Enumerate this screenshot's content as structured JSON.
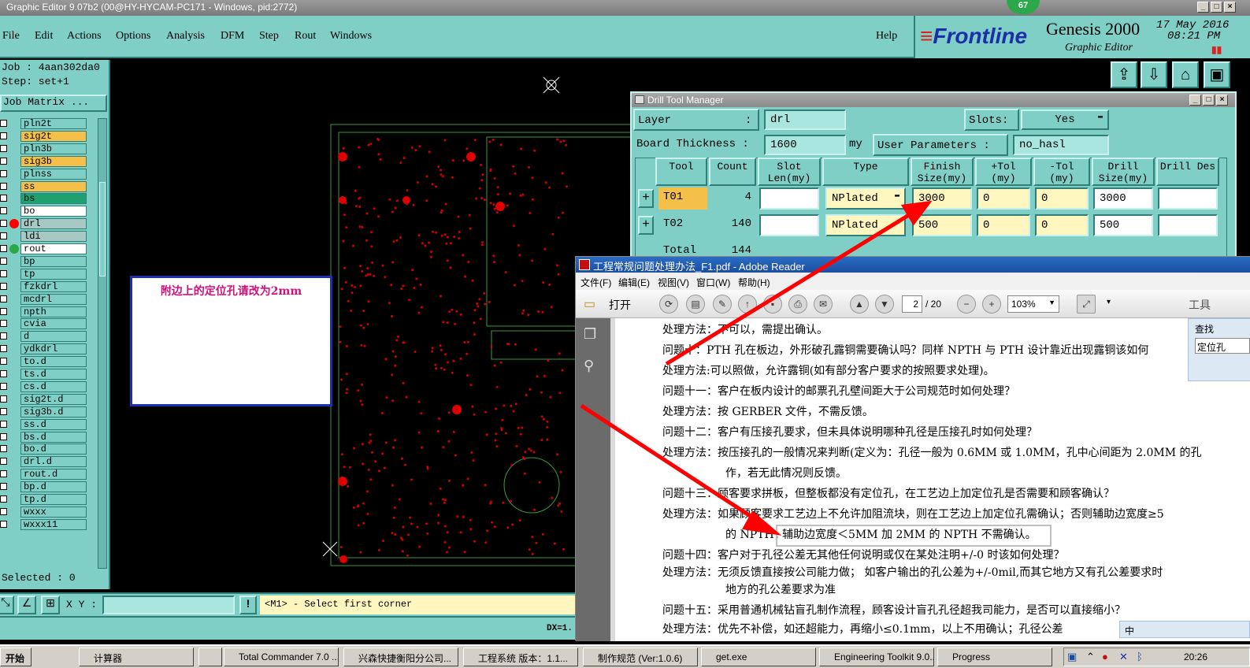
{
  "window": {
    "title": "Graphic Editor 9.07b2 (00@HY-HYCAM-PC171 - Windows, pid:2772)",
    "badge": "67"
  },
  "menu": {
    "items": [
      "File",
      "Edit",
      "Actions",
      "Options",
      "Analysis",
      "DFM",
      "Step",
      "Rout",
      "Windows"
    ],
    "help": "Help"
  },
  "brand": {
    "logo": "Frontline",
    "product": "Genesis 2000",
    "subtitle": "Graphic Editor",
    "date": "17 May 2016",
    "time": "08:21 PM"
  },
  "left_panel": {
    "job": "Job : 4aan302da0",
    "step": "Step: set+1",
    "job_matrix": "Job Matrix ...",
    "selected": "Selected : 0",
    "layers": [
      {
        "name": "pln2t",
        "color": "#7fcfc7"
      },
      {
        "name": "sig2t",
        "color": "#f5c04a"
      },
      {
        "name": "pln3b",
        "color": "#7fcfc7"
      },
      {
        "name": "sig3b",
        "color": "#f5c04a"
      },
      {
        "name": "plnss",
        "color": "#7fcfc7"
      },
      {
        "name": "ss",
        "color": "#f5c04a"
      },
      {
        "name": "bs",
        "color": "#20a070"
      },
      {
        "name": "bo",
        "color": "#ffffff"
      },
      {
        "name": "drl",
        "color": "#a8c8c4"
      },
      {
        "name": "ldi",
        "color": "#a8c8c4"
      },
      {
        "name": "rout",
        "color": "#ffffff"
      },
      {
        "name": "bp",
        "color": "#7fcfc7"
      },
      {
        "name": "tp",
        "color": "#7fcfc7"
      },
      {
        "name": "fzkdrl",
        "color": "#7fcfc7"
      },
      {
        "name": "mcdrl",
        "color": "#7fcfc7"
      },
      {
        "name": "npth",
        "color": "#7fcfc7"
      },
      {
        "name": "cvia",
        "color": "#7fcfc7"
      },
      {
        "name": "d",
        "color": "#7fcfc7"
      },
      {
        "name": "ydkdrl",
        "color": "#7fcfc7"
      },
      {
        "name": "to.d",
        "color": "#7fcfc7"
      },
      {
        "name": "ts.d",
        "color": "#7fcfc7"
      },
      {
        "name": "cs.d",
        "color": "#7fcfc7"
      },
      {
        "name": "sig2t.d",
        "color": "#7fcfc7"
      },
      {
        "name": "sig3b.d",
        "color": "#7fcfc7"
      },
      {
        "name": "ss.d",
        "color": "#7fcfc7"
      },
      {
        "name": "bs.d",
        "color": "#7fcfc7"
      },
      {
        "name": "bo.d",
        "color": "#7fcfc7"
      },
      {
        "name": "drl.d",
        "color": "#7fcfc7"
      },
      {
        "name": "rout.d",
        "color": "#7fcfc7"
      },
      {
        "name": "bp.d",
        "color": "#7fcfc7"
      },
      {
        "name": "tp.d",
        "color": "#7fcfc7"
      },
      {
        "name": "wxxx",
        "color": "#7fcfc7"
      },
      {
        "name": "wxxx11",
        "color": "#7fcfc7"
      }
    ]
  },
  "note": {
    "text": "附边上的定位孔请改为2mm"
  },
  "bottom": {
    "xy_label": "X Y :",
    "prompt": "<M1> - Select first corner",
    "dx": "DX=1."
  },
  "drill_tool_manager": {
    "title": "Drill Tool Manager",
    "layer_label": "Layer",
    "layer_value": "drl",
    "slots_label": "Slots:",
    "slots_value": "Yes",
    "thickness_label": "Board Thickness :",
    "thickness_value": "1600",
    "thickness_unit": "my",
    "user_params_label": "User Parameters :",
    "user_params_value": "no_hasl",
    "columns": [
      "Tool",
      "Count",
      "Slot Len(my)",
      "Type",
      "Finish Size(my)",
      "+Tol (my)",
      "-Tol (my)",
      "Drill Size(my)",
      "Drill Des"
    ],
    "rows": [
      {
        "tool": "T01",
        "count": "4",
        "type": "NPlated",
        "finish": "3000",
        "ptol": "0",
        "ntol": "0",
        "drill": "3000"
      },
      {
        "tool": "T02",
        "count": "140",
        "type": "NPlated",
        "finish": "500",
        "ptol": "0",
        "ntol": "0",
        "drill": "500"
      }
    ],
    "total_label": "Total",
    "total_value": "144"
  },
  "reader": {
    "title": "工程常规问题处理办法_F1.pdf - Adobe Reader",
    "menu": [
      "文件(F)",
      "编辑(E)",
      "视图(V)",
      "窗口(W)",
      "帮助(H)"
    ],
    "open_label": "打开",
    "page": "2",
    "pages": "/ 20",
    "zoom": "103%",
    "tools_label": "工具",
    "find_label": "查找",
    "find_value": "定位孔",
    "lines": [
      "处理方法：不可以，需提出确认。",
      "问题十：PTH 孔在板边，外形破孔露铜需要确认吗？同样 NPTH 与 PTH 设计靠近出现露铜该如何",
      "处理方法:可以照做，允许露铜(如有部分客户要求的按照要求处理)。",
      "问题十一：客户在板内设计的邮票孔孔壁间距大于公司规范时如何处理？",
      "处理方法：按 GERBER 文件，不需反馈。",
      "问题十二：客户有压接孔要求，但未具体说明哪种孔径是压接孔时如何处理？",
      "处理方法：按压接孔的一般情况来判断(定义为：孔径一般为 0.6MM 或 1.0MM，孔中心间距为 2.0MM 的孔",
      "作，若无此情况则反馈。",
      "问题十三：顾客要求拼板，但整板都没有定位孔，在工艺边上加定位孔是否需要和顾客确认？",
      "处理方法：如果顾客要求工艺边上不允许加阻流块，则在工艺边上加定位孔需确认；否则辅助边宽度≥5",
      "的 NPTH；",
      "辅助边宽度＜5MM 加 2MM 的 NPTH 不需确认。",
      "问题十四：客户对于孔径公差无其他任何说明或仅在某处注明+/-0 时该如何处理？",
      "处理方法：无须反馈直接按公司能力做；  如客户输出的孔公差为+/-0mil,而其它地方又有孔公差要求时",
      "地方的孔公差要求为准",
      "问题十五：采用普通机械钻盲孔制作流程，顾客设计盲孔孔径超我司能力，是否可以直接缩小？",
      "处理方法：优先不补偿，如还超能力，再缩小≤0.1mm，以上不用确认；孔径公差"
    ]
  },
  "taskbar": {
    "start": "开始",
    "tasks": [
      "计算器",
      "",
      "Total Commander 7.0 ...",
      "兴森快捷衡阳分公司...",
      "工程系统  版本：1.1...",
      "制作规范 (Ver:1.0.6)",
      "get.exe",
      "Engineering Toolkit 9.0...",
      "Progress"
    ],
    "clock": "20:26",
    "ime": "中"
  }
}
